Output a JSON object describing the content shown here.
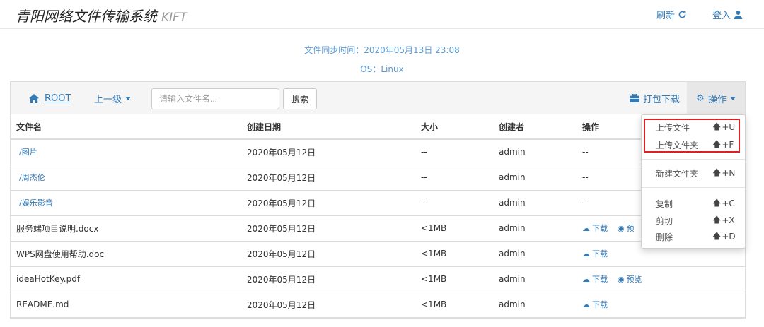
{
  "header": {
    "title": "青阳网络文件传输系统",
    "subtitle": "KIFT",
    "refresh_label": "刷新",
    "login_label": "登入"
  },
  "sync": {
    "time_text": "文件同步时间：2020年05月13日 23:08",
    "os_text": "OS：Linux"
  },
  "toolbar": {
    "root_label": "ROOT",
    "up_label": "上一级",
    "search_placeholder": "请输入文件名...",
    "search_button": "搜索",
    "pack_download": "打包下载",
    "operations": "操作"
  },
  "table": {
    "columns": [
      "文件名",
      "创建日期",
      "大小",
      "创建者",
      "操作"
    ],
    "rows": [
      {
        "name": "/图片",
        "date": "2020年05月12日",
        "size": "--",
        "creator": "admin",
        "ops_text": "--"
      },
      {
        "name": "/周杰伦",
        "date": "2020年05月12日",
        "size": "--",
        "creator": "admin",
        "ops_text": "--"
      },
      {
        "name": "/娱乐影音",
        "date": "2020年05月12日",
        "size": "--",
        "creator": "admin",
        "ops_text": "--"
      },
      {
        "name": "服务端项目说明.docx",
        "date": "2020年05月12日",
        "size": "<1MB",
        "creator": "admin",
        "download": "下载",
        "preview": "预"
      },
      {
        "name": "WPS网盘使用帮助.doc",
        "date": "2020年05月12日",
        "size": "<1MB",
        "creator": "admin",
        "download": "下载"
      },
      {
        "name": "ideaHotKey.pdf",
        "date": "2020年05月12日",
        "size": "<1MB",
        "creator": "admin",
        "download": "下载",
        "preview": "预览"
      },
      {
        "name": "README.md",
        "date": "2020年05月12日",
        "size": "<1MB",
        "creator": "admin",
        "download": "下载"
      }
    ]
  },
  "menu": {
    "items": [
      {
        "label": "上传文件",
        "shortcut": "+U"
      },
      {
        "label": "上传文件夹",
        "shortcut": "+F"
      },
      {
        "label": "新建文件夹",
        "shortcut": "+N"
      },
      {
        "label": "复制",
        "shortcut": "+C"
      },
      {
        "label": "剪切",
        "shortcut": "+X"
      },
      {
        "label": "删除",
        "shortcut": "+D"
      }
    ]
  },
  "colors": {
    "link": "#337ab7",
    "highlight": "#e02020"
  }
}
